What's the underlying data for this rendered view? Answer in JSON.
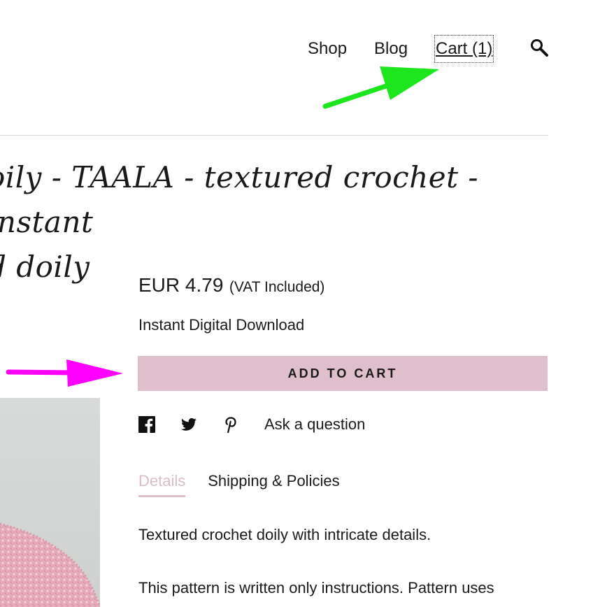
{
  "nav": {
    "shop": "Shop",
    "blog": "Blog",
    "cart": "Cart (1)"
  },
  "icons": {
    "search": "search-icon",
    "facebook": "facebook-icon",
    "twitter": "twitter-icon",
    "pinterest": "pinterest-icon"
  },
  "product": {
    "title_line1": "oily - TAALA - textured crochet - instant",
    "title_line2": "d doily",
    "price": "EUR 4.79",
    "vat": "(VAT Included)",
    "delivery": "Instant Digital Download",
    "add_to_cart": "ADD TO CART",
    "ask_question": "Ask a question"
  },
  "tabs": [
    {
      "label": "Details",
      "active": true
    },
    {
      "label": "Shipping & Policies",
      "active": false
    }
  ],
  "description": {
    "line1": "Textured crochet doily with intricate details.",
    "line2": "This pattern is written only instructions. Pattern uses"
  },
  "colors": {
    "accent": "#dfbfcc",
    "annotation_green": "#1ee61e",
    "annotation_magenta": "#ff00ff"
  }
}
